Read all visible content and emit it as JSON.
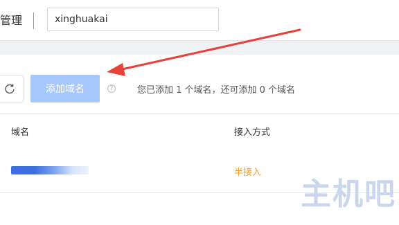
{
  "header": {
    "title": "管理",
    "domain_value": "xinghuakai"
  },
  "toolbar": {
    "add_label": "添加域名",
    "help_glyph": "?",
    "quota_text": "您已添加 1 个域名，还可添加 0 个域名"
  },
  "table": {
    "columns": [
      "域名",
      "接入方式"
    ],
    "rows": [
      {
        "domain": "",
        "access": "半接入"
      }
    ]
  },
  "watermark": "主机吧",
  "colors": {
    "add_button_bg": "#a6c8fb",
    "access_text": "#f0a020",
    "annotation_arrow": "#e8413c"
  },
  "icons": {
    "refresh": "refresh-icon",
    "help": "help-icon",
    "arrow": "arrow-annotation"
  }
}
